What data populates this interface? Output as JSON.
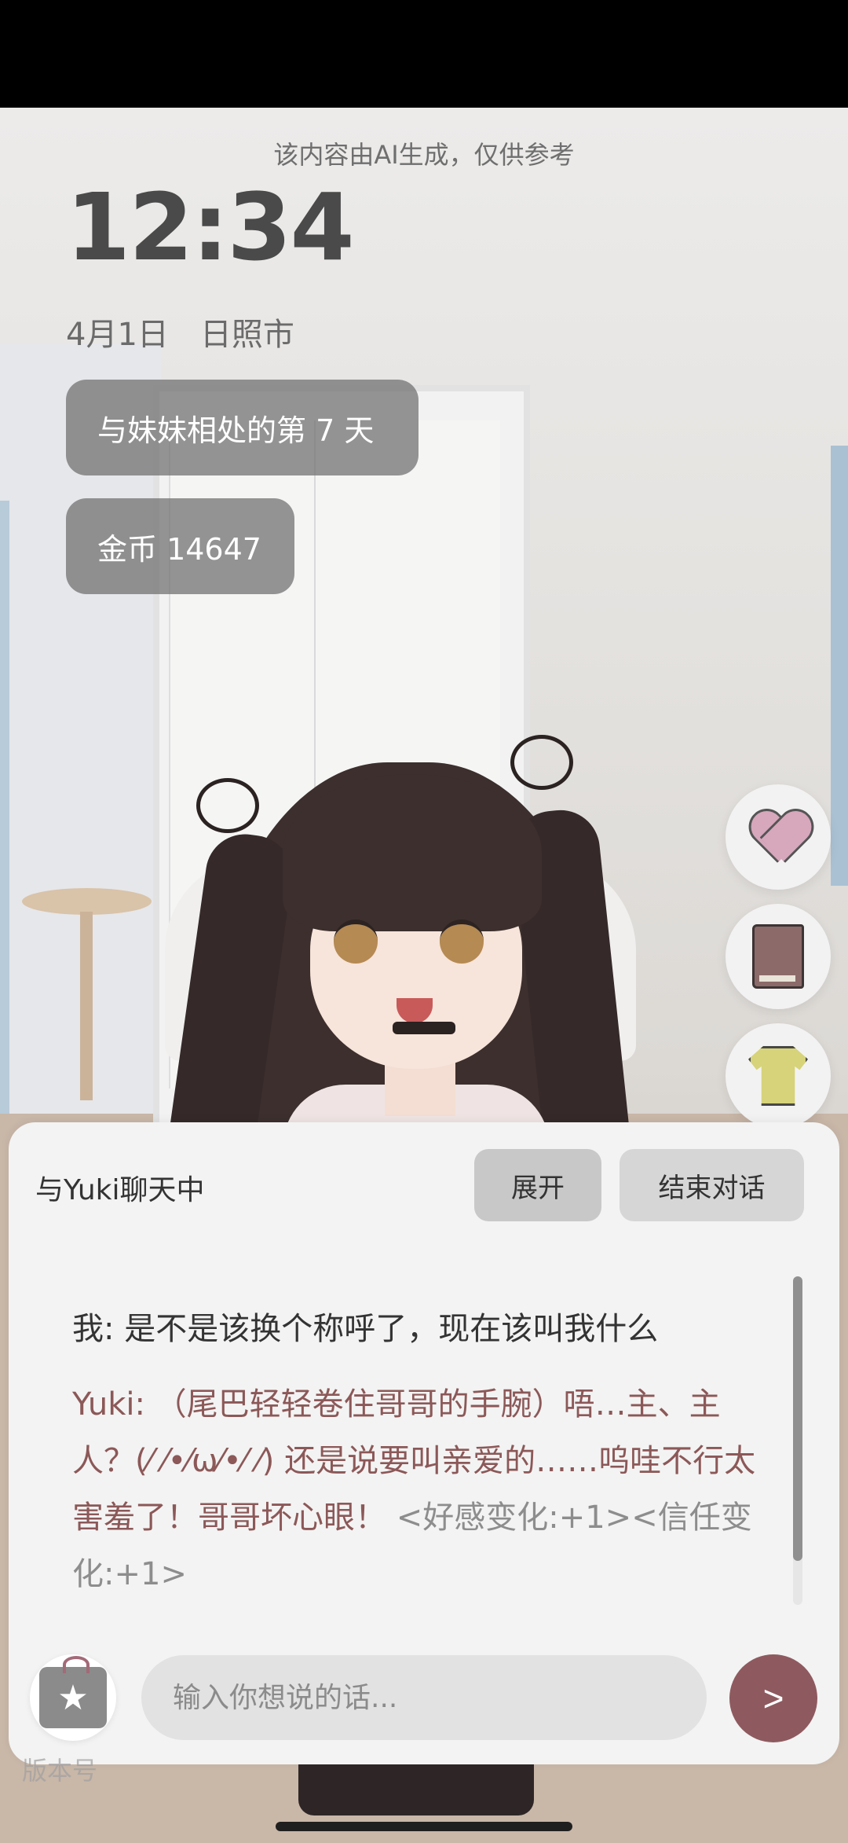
{
  "ai_notice": "该内容由AI生成，仅供参考",
  "clock": "12:34",
  "date": {
    "day": "4月1日",
    "city": "日照市"
  },
  "stats": {
    "days_together": "与妹妹相处的第 7 天",
    "coins": "金币 14647"
  },
  "side_actions": [
    {
      "icon": "heart-icon",
      "color": "#d7a7bc"
    },
    {
      "icon": "book-icon",
      "color": "#8c6a6a"
    },
    {
      "icon": "shirt-icon",
      "color": "#d6d37a"
    }
  ],
  "chat": {
    "title": "与Yuki聊天中",
    "expand_label": "展开",
    "end_label": "结束对话",
    "messages": [
      {
        "speaker": "我:",
        "text": "是不是该换个称呼了，现在该叫我什么"
      },
      {
        "speaker": "Yuki:",
        "text": "（尾巴轻轻卷住哥哥的手腕）唔…主、主人？(⁄ ⁄•⁄ω⁄•⁄ ⁄) 还是说要叫亲爱的……呜哇不行太害羞了！哥哥坏心眼！",
        "meta": "<好感变化:+1><信任变化:+1>"
      }
    ],
    "input_placeholder": "输入你想说的话...",
    "send_label": ">",
    "accent_color": "#8e5a5f"
  },
  "version_label": "版本号"
}
